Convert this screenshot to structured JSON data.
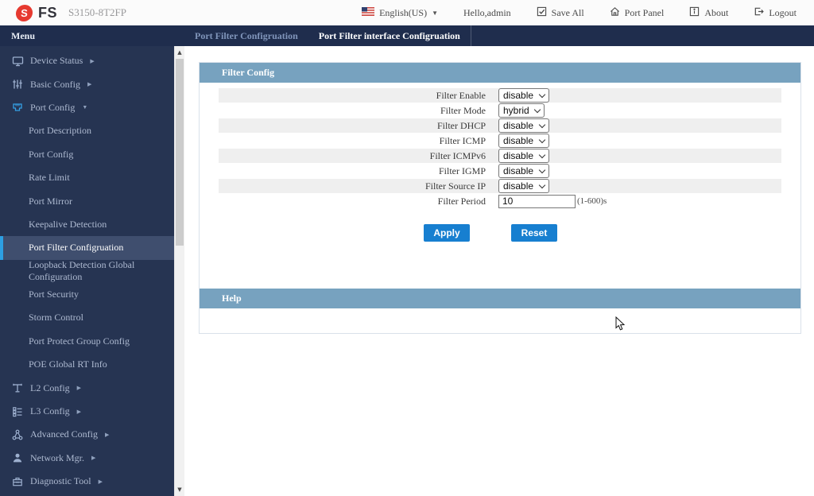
{
  "header": {
    "logo_letter": "S",
    "logo_text": "FS",
    "model": "S3150-8T2FP",
    "language": "English(US)",
    "greeting": "Hello,admin",
    "actions": [
      {
        "label": "Save All",
        "icon": "save-all-icon"
      },
      {
        "label": "Port Panel",
        "icon": "port-panel-icon"
      },
      {
        "label": "About",
        "icon": "about-icon"
      },
      {
        "label": "Logout",
        "icon": "logout-icon"
      }
    ]
  },
  "menubar": {
    "menu_label": "Menu",
    "tabs": [
      {
        "label": "Port Filter Configruation",
        "active": false
      },
      {
        "label": "Port Filter interface Configruation",
        "active": true
      }
    ]
  },
  "sidebar": {
    "items": [
      {
        "id": "device-status",
        "label": "Device Status",
        "icon": "monitor-icon",
        "arrow": "right",
        "level": 0
      },
      {
        "id": "basic-config",
        "label": "Basic Config",
        "icon": "sliders-icon",
        "arrow": "right",
        "level": 0
      },
      {
        "id": "port-config",
        "label": "Port Config",
        "icon": "port-icon",
        "arrow": "down",
        "level": 0,
        "icon_color": "#35a1e6"
      },
      {
        "id": "port-description",
        "label": "Port Description",
        "level": 1
      },
      {
        "id": "port-config-sub",
        "label": "Port Config",
        "level": 1
      },
      {
        "id": "rate-limit",
        "label": "Rate Limit",
        "level": 1
      },
      {
        "id": "port-mirror",
        "label": "Port Mirror",
        "level": 1
      },
      {
        "id": "keepalive-detection",
        "label": "Keepalive Detection",
        "level": 1
      },
      {
        "id": "port-filter-configruation",
        "label": "Port Filter Configruation",
        "level": 1,
        "selected": true
      },
      {
        "id": "loopback-detection-global-configuration",
        "label": "Loopback Detection Global Configuration",
        "level": 1
      },
      {
        "id": "port-security",
        "label": "Port Security",
        "level": 1
      },
      {
        "id": "storm-control",
        "label": "Storm Control",
        "level": 1
      },
      {
        "id": "port-protect-group-config",
        "label": "Port Protect Group Config",
        "level": 1
      },
      {
        "id": "poe-global-rt-info",
        "label": "POE Global RT Info",
        "level": 1
      },
      {
        "id": "l2-config",
        "label": "L2 Config",
        "icon": "l2-icon",
        "arrow": "right",
        "level": 0
      },
      {
        "id": "l3-config",
        "label": "L3 Config",
        "icon": "l3-icon",
        "arrow": "right",
        "level": 0
      },
      {
        "id": "advanced-config",
        "label": "Advanced Config",
        "icon": "advanced-icon",
        "arrow": "right",
        "level": 0
      },
      {
        "id": "network-mgr",
        "label": "Network Mgr.",
        "icon": "person-icon",
        "arrow": "right",
        "level": 0
      },
      {
        "id": "diagnostic-tool",
        "label": "Diagnostic Tool",
        "icon": "toolbox-icon",
        "arrow": "right",
        "level": 0
      }
    ]
  },
  "main": {
    "filter_config": {
      "title": "Filter Config",
      "rows": [
        {
          "label": "Filter Enable",
          "type": "select",
          "value": "disable"
        },
        {
          "label": "Filter Mode",
          "type": "select",
          "value": "hybrid"
        },
        {
          "label": "Filter DHCP",
          "type": "select",
          "value": "disable"
        },
        {
          "label": "Filter ICMP",
          "type": "select",
          "value": "disable"
        },
        {
          "label": "Filter ICMPv6",
          "type": "select",
          "value": "disable"
        },
        {
          "label": "Filter IGMP",
          "type": "select",
          "value": "disable"
        },
        {
          "label": "Filter Source IP",
          "type": "select",
          "value": "disable"
        },
        {
          "label": "Filter Period",
          "type": "input",
          "value": "10",
          "suffix": "(1-600)s"
        }
      ],
      "apply_label": "Apply",
      "reset_label": "Reset"
    },
    "help": {
      "title": "Help"
    }
  },
  "colors": {
    "logo_red": "#e63a30",
    "navy": "#1f2d4d",
    "sidebar_navy": "#263452",
    "selected_item_bg": "#3f4e6e",
    "selected_accent_blue": "#2d9fe2",
    "section_header_blue": "#77a2bf",
    "button_blue": "#177fd0",
    "alt_row_gray": "#efefef"
  }
}
